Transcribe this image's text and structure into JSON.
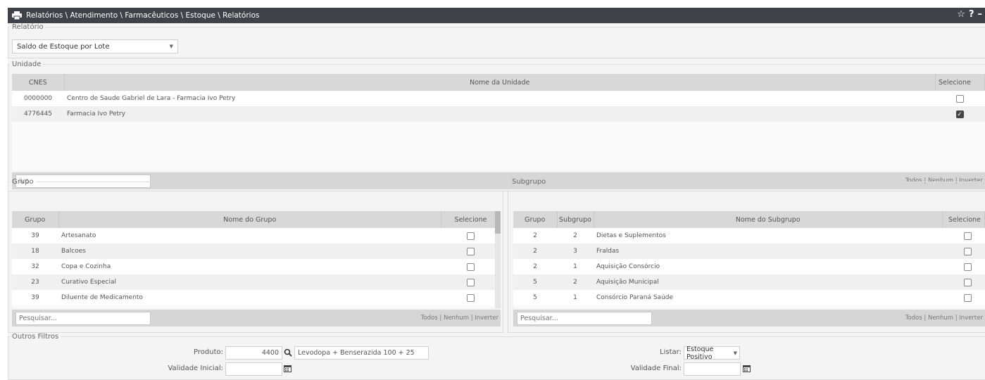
{
  "window": {
    "title": "Relatórios \\ Atendimento \\ Farmacêuticos \\ Estoque \\ Relatórios",
    "star_icon": "☆",
    "help_icon": "?",
    "minimize_icon": "–"
  },
  "relatorio": {
    "legend": "Relatório",
    "selected": "Saldo de Estoque por Lote"
  },
  "unidade": {
    "legend": "Unidade",
    "headers": {
      "cnes": "CNES",
      "nome": "Nome da Unidade",
      "selecione": "Selecione"
    },
    "rows": [
      {
        "cnes": "0000000",
        "nome": "Centro de Saude Gabriel de Lara - Farmacia Ivo Petry",
        "checked": false
      },
      {
        "cnes": "4776445",
        "nome": "Farmacia Ivo Petry",
        "checked": true
      }
    ],
    "search_value": "ivo",
    "links": [
      "Todos",
      "Nenhum",
      "Inverter"
    ]
  },
  "grupo": {
    "legend": "Grupo",
    "headers": {
      "grupo": "Grupo",
      "nome": "Nome do Grupo",
      "selecione": "Selecione"
    },
    "rows": [
      {
        "grupo": "39",
        "nome": "Artesanato"
      },
      {
        "grupo": "18",
        "nome": "Balcoes"
      },
      {
        "grupo": "32",
        "nome": "Copa e Cozinha"
      },
      {
        "grupo": "23",
        "nome": "Curativo Especial"
      },
      {
        "grupo": "39",
        "nome": "Diluente de Medicamento"
      }
    ],
    "search_placeholder": "Pesquisar...",
    "links": [
      "Todos",
      "Nenhum",
      "Inverter"
    ]
  },
  "subgrupo": {
    "legend": "Subgrupo",
    "headers": {
      "grupo": "Grupo",
      "subgrupo": "Subgrupo",
      "nome": "Nome do Subgrupo",
      "selecione": "Selecione"
    },
    "rows": [
      {
        "grupo": "2",
        "subgrupo": "2",
        "nome": "Dietas e Suplementos"
      },
      {
        "grupo": "2",
        "subgrupo": "3",
        "nome": "Fraldas"
      },
      {
        "grupo": "2",
        "subgrupo": "1",
        "nome": "Aquisição Consórcio"
      },
      {
        "grupo": "5",
        "subgrupo": "2",
        "nome": "Aquisição Municipal"
      },
      {
        "grupo": "5",
        "subgrupo": "1",
        "nome": "Consórcio Paraná Saúde"
      }
    ],
    "search_placeholder": "Pesquisar...",
    "links": [
      "Todos",
      "Nenhum",
      "Inverter"
    ]
  },
  "outros": {
    "legend": "Outros Filtros",
    "produto_label": "Produto:",
    "produto_code": "4400",
    "produto_name": "Levodopa + Benserazida 100 + 25",
    "validade_inicial_label": "Validade Inicial:",
    "listar_label": "Listar:",
    "listar_value": "Estoque Positivo",
    "validade_final_label": "Validade Final:"
  }
}
